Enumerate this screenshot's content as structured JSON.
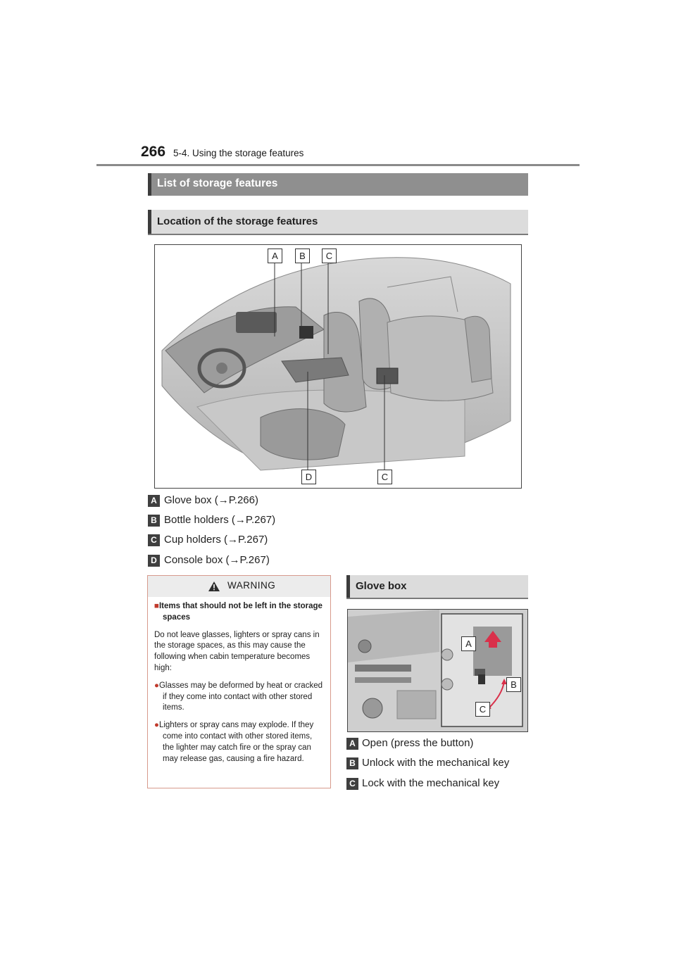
{
  "header": {
    "page_number": "266",
    "chapter": "5-4. Using the storage features"
  },
  "section_title": "List of storage features",
  "location": {
    "heading": "Location of the storage features",
    "callouts_top": [
      "A",
      "B",
      "C"
    ],
    "callouts_bottom": [
      "D",
      "C"
    ],
    "legend": [
      {
        "key": "A",
        "text": "Glove box (→P.266)"
      },
      {
        "key": "B",
        "text": "Bottle holders (→P.267)"
      },
      {
        "key": "C",
        "text": "Cup holders (→P.267)"
      },
      {
        "key": "D",
        "text": "Console box (→P.267)"
      }
    ]
  },
  "warning": {
    "title": "WARNING",
    "heading": "Items that should not be left in the storage spaces",
    "body": "Do not leave glasses, lighters or spray cans in the storage spaces, as this may cause the following when cabin temperature becomes high:",
    "bullets": [
      "Glasses may be deformed by heat or cracked if they come into contact with other stored items.",
      "Lighters or spray cans may explode. If they come into contact with other stored items, the lighter may catch fire or the spray can may release gas, causing a fire hazard."
    ]
  },
  "glove_box": {
    "heading": "Glove box",
    "callouts": [
      "A",
      "B",
      "C"
    ],
    "legend": [
      {
        "key": "A",
        "text": "Open (press the button)"
      },
      {
        "key": "B",
        "text": "Unlock with the mechanical key"
      },
      {
        "key": "C",
        "text": "Lock with the mechanical key"
      }
    ]
  },
  "colors": {
    "section_bar": "#8f8f8f",
    "accent_red": "#d9304a",
    "warning_border": "#d79a8c"
  }
}
